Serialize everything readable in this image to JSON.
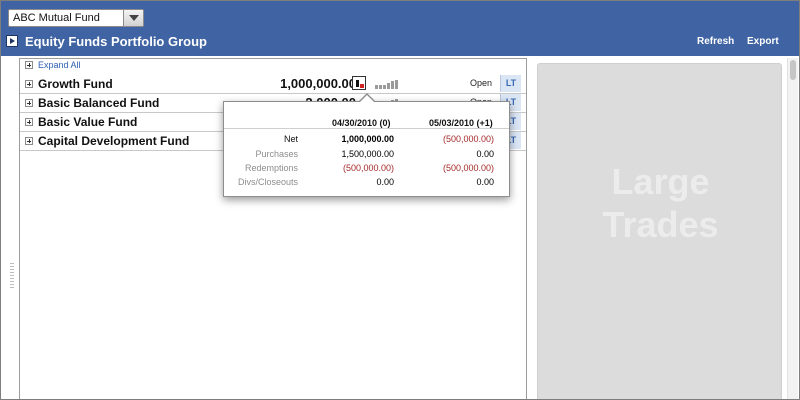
{
  "header": {
    "fund_select": {
      "value": "ABC Mutual Fund"
    },
    "title": "Equity Funds Portfolio Group",
    "refresh_label": "Refresh",
    "export_label": "Export"
  },
  "main": {
    "expand_all_label": "Expand All",
    "funds": [
      {
        "name": "Growth Fund",
        "amount": "1,000,000.00",
        "status": "Open",
        "lt": "LT"
      },
      {
        "name": "Basic Balanced Fund",
        "amount": "2,000.00",
        "status": "Open",
        "lt": "LT"
      },
      {
        "name": "Basic Value Fund",
        "amount": "",
        "status": "",
        "lt": "LT"
      },
      {
        "name": "Capital Development Fund",
        "amount": "",
        "status": "",
        "lt": "LT"
      }
    ]
  },
  "popover": {
    "col1_header": "04/30/2010 (0)",
    "col2_header": "05/03/2010 (+1)",
    "rows": [
      {
        "label": "Net",
        "v1": "1,000,000.00",
        "v2": "(500,000.00)"
      },
      {
        "label": "Purchases",
        "v1": "1,500,000.00",
        "v2": "0.00"
      },
      {
        "label": "Redemptions",
        "v1": "(500,000.00)",
        "v2": "(500,000.00)"
      },
      {
        "label": "Divs/Closeouts",
        "v1": "0.00",
        "v2": "0.00"
      }
    ]
  },
  "side_panel": {
    "title_line1": "Large",
    "title_line2": "Trades"
  },
  "colors": {
    "header": "#3f63a3",
    "link": "#2f62b3",
    "negative": "#a52a2a",
    "lt_bg": "#dbe6f5",
    "side_panel": "#dcdcdc"
  },
  "icons": [
    "play-icon",
    "chevron-down-icon",
    "plus-icon",
    "sparkline-icon",
    "bar-mini-chart-icon"
  ]
}
